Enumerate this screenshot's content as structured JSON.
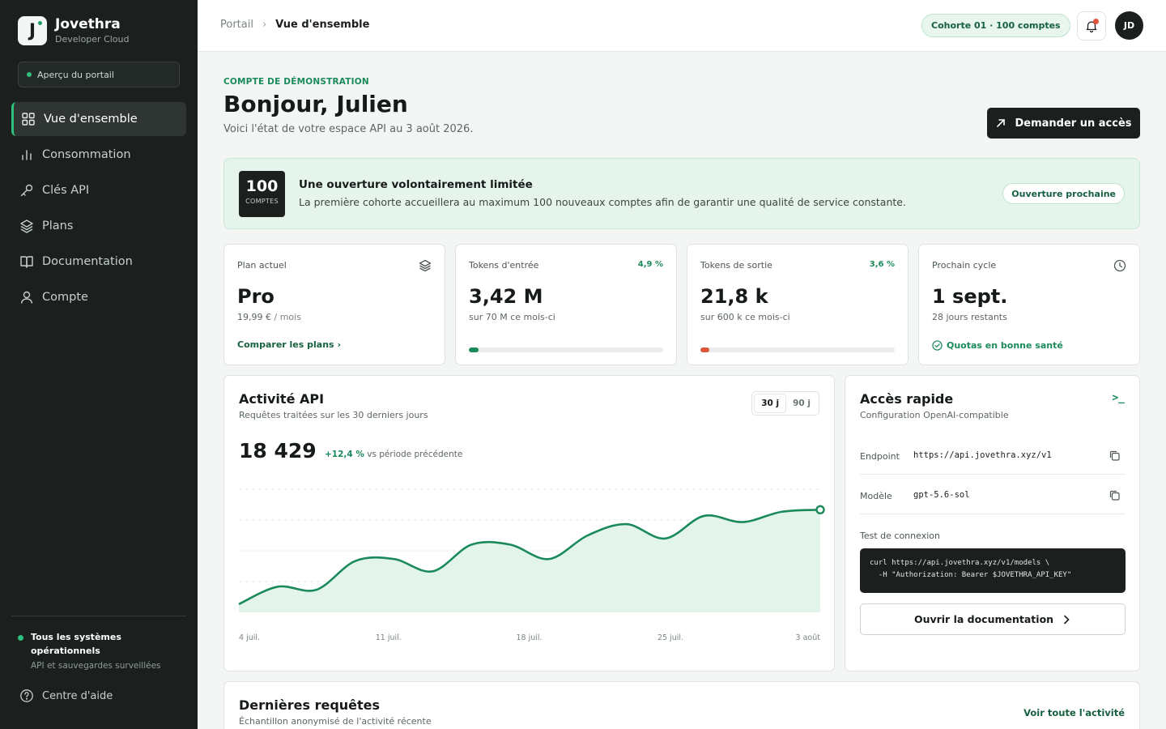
{
  "brand": {
    "name": "Jovethra",
    "subtitle": "Developer Cloud",
    "logo_letter": "J"
  },
  "sidebar": {
    "preview_label": "Aperçu du portail",
    "items": [
      {
        "label": "Vue d'ensemble",
        "icon": "grid-icon",
        "active": true
      },
      {
        "label": "Consommation",
        "icon": "bar-chart-icon"
      },
      {
        "label": "Clés API",
        "icon": "key-icon"
      },
      {
        "label": "Plans",
        "icon": "layers-icon"
      },
      {
        "label": "Documentation",
        "icon": "book-icon"
      },
      {
        "label": "Compte",
        "icon": "user-icon"
      }
    ],
    "status_title": "Tous les systèmes opérationnels",
    "status_sub": "API et sauvegardes surveillées",
    "help_label": "Centre d'aide"
  },
  "topbar": {
    "breadcrumb": [
      "Portail",
      "Vue d'ensemble"
    ],
    "cohort_label": "Cohorte 01 · 100 comptes",
    "avatar_initials": "JD"
  },
  "header": {
    "eyebrow": "COMPTE DE DÉMONSTRATION",
    "greeting": "Bonjour, Julien",
    "subtitle": "Voici l'état de votre espace API au 3 août 2026.",
    "cta_label": "Demander un accès"
  },
  "banner": {
    "badge_number": "100",
    "badge_unit": "COMPTES",
    "title": "Une ouverture volontairement limitée",
    "text": "La première cohorte accueillera au maximum 100 nouveaux comptes afin de garantir une qualité de service constante.",
    "pill_label": "Ouverture prochaine"
  },
  "stats": {
    "plan": {
      "label": "Plan actuel",
      "value": "Pro",
      "price": "19,99 €",
      "period": " / mois",
      "link": "Comparer les plans"
    },
    "input": {
      "label": "Tokens d'entrée",
      "pct": "4,9 %",
      "value": "3,42 M",
      "sub": "sur 70 M ce mois-ci",
      "progress": 0.049,
      "color": "#1a8a5a"
    },
    "output": {
      "label": "Tokens de sortie",
      "pct": "3,6 %",
      "value": "21,8 k",
      "sub": "sur 600 k ce mois-ci",
      "progress": 0.036,
      "color": "#e0553b"
    },
    "cycle": {
      "label": "Prochain cycle",
      "value": "1 sept.",
      "sub": "28 jours restants",
      "status": "Quotas en bonne santé"
    }
  },
  "activity": {
    "title": "Activité API",
    "subtitle": "Requêtes traitées sur les 30 derniers jours",
    "ranges": [
      "30 j",
      "90 j"
    ],
    "total": "18 429",
    "delta": "+12,4 %",
    "delta_suffix": " vs période précédente",
    "x_ticks": [
      "4 juil.",
      "11 juil.",
      "18 juil.",
      "25 juil.",
      "3 août"
    ]
  },
  "chart_data": {
    "type": "area",
    "x": [
      "4 juil.",
      "6 juil.",
      "8 juil.",
      "10 juil.",
      "12 juil.",
      "14 juil.",
      "16 juil.",
      "18 juil.",
      "20 juil.",
      "22 juil.",
      "24 juil.",
      "26 juil.",
      "28 juil.",
      "30 juil.",
      "1 août",
      "3 août"
    ],
    "values": [
      0.08,
      0.25,
      0.22,
      0.5,
      0.52,
      0.4,
      0.66,
      0.66,
      0.52,
      0.75,
      0.86,
      0.72,
      0.94,
      0.88,
      0.98,
      1.0
    ],
    "ylim": [
      0,
      1.2
    ],
    "grid": true,
    "color": "#1a8a5a"
  },
  "quick": {
    "title": "Accès rapide",
    "subtitle": "Configuration OpenAI-compatible",
    "endpoint_label": "Endpoint",
    "endpoint_value": "https://api.jovethra.xyz/v1",
    "model_label": "Modèle",
    "model_value": "gpt-5.6-sol",
    "test_label": "Test de connexion",
    "code_line1": "curl https://api.jovethra.xyz/v1/models \\",
    "code_line2": "  -H \"Authorization: Bearer $JOVETHRA_API_KEY\"",
    "doc_button": "Ouvrir la documentation"
  },
  "recent": {
    "title": "Dernières requêtes",
    "subtitle": "Échantillon anonymisé de l'activité récente",
    "link": "Voir toute l'activité"
  }
}
